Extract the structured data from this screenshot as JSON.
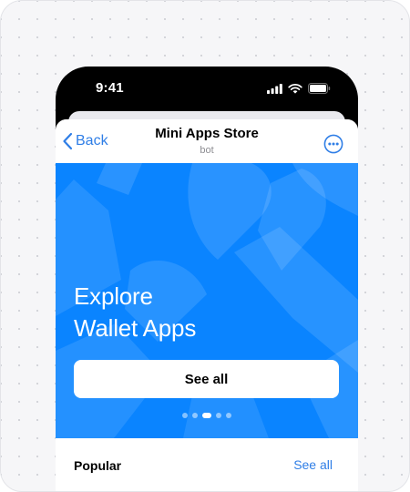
{
  "status_bar": {
    "time": "9:41"
  },
  "nav": {
    "back_label": "Back",
    "title": "Mini Apps Store",
    "subtitle": "bot"
  },
  "banner": {
    "title_line1": "Explore",
    "title_line2": "Wallet Apps",
    "button_label": "See all",
    "dots_total": 5,
    "active_dot": 3
  },
  "popular": {
    "title": "Popular",
    "link_label": "See all"
  },
  "colors": {
    "accent": "#2f7ee6",
    "banner": "#0a84ff",
    "phone": "#000000"
  },
  "icons": [
    "signal-icon",
    "wifi-icon",
    "battery-icon",
    "chevron-left-icon",
    "more-icon"
  ]
}
